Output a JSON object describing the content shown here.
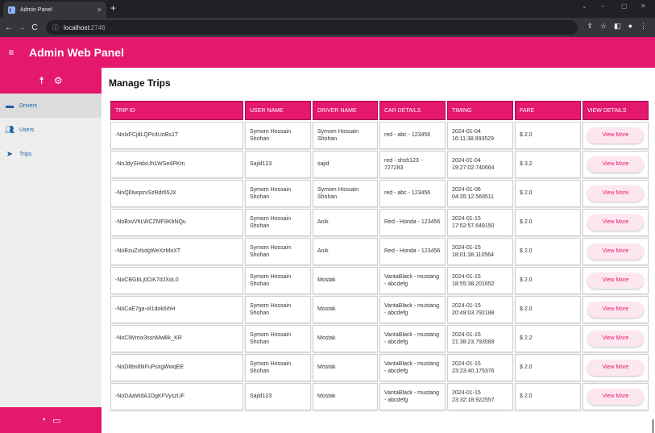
{
  "browser": {
    "tab_title": "Admin Panel",
    "tab_close": "×",
    "new_tab": "+",
    "address_host": "localhost:",
    "address_port": "2746",
    "window_controls": [
      "⌄",
      "–",
      "▢",
      "✕"
    ]
  },
  "app": {
    "title": "Admin Web Panel"
  },
  "main": {
    "page_title": "Manage Trips",
    "table": {
      "headers": [
        "TRIP ID",
        "USER NAME",
        "DRIVER NAME",
        "CAR DETAILS",
        "TIMING",
        "FARE",
        "VIEW DETAILS"
      ],
      "rows": [
        {
          "trip_id": "-NnIxFCjdLQPc4UoBs1T",
          "user": "Symom Hossain Shohan",
          "driver": "Symom Hossain Shohan",
          "car": "red - abc - 123456",
          "timing": "2024-01-04 16:11:38.993529",
          "fare": "$ 2.0",
          "action": "View More"
        },
        {
          "trip_id": "-NnJdySHdxUh1WSe4PKm",
          "user": "Sajid123",
          "driver": "sajid",
          "car": "red - shsh123 - 727283",
          "timing": "2024-01-04 19:27:02.740664",
          "fare": "$ 3.2",
          "action": "View More"
        },
        {
          "trip_id": "-NnQl0wqsrvSzRdr65JX",
          "user": "Symom Hossain Shohan",
          "driver": "Symom Hossain Shohan",
          "car": "red - abc - 123456",
          "timing": "2024-01-06 04:35:12.569511",
          "fare": "$ 2.0",
          "action": "View More"
        },
        {
          "trip_id": "-NoBxvVhLWCZMF9KbNQu",
          "user": "Symom Hossain Shohan",
          "driver": "Anik",
          "car": "Red - Honda - 123456",
          "timing": "2024-01-15 17:52:57.649150",
          "fare": "$ 2.0",
          "action": "View More"
        },
        {
          "trip_id": "-NoBzuZvlsdgWeXzMoXT",
          "user": "Symom Hossain Shohan",
          "driver": "Anik",
          "car": "Red - Honda - 123456",
          "timing": "2024-01-15 18:01:38.110564",
          "fare": "$ 2.0",
          "action": "View More"
        },
        {
          "trip_id": "-NoCBGbLj0CiK7dJXoL0",
          "user": "Symom Hossain Shohan",
          "driver": "Mostak",
          "car": "VantaBlack - mustang - abcdefg",
          "timing": "2024-01-15 18:55:38.201652",
          "fare": "$ 2.0",
          "action": "View More"
        },
        {
          "trip_id": "-NoCaE7ga-oI1dok6ihH",
          "user": "Symom Hossain Shohan",
          "driver": "Mostak",
          "car": "VantaBlack - mustang - abcdefg",
          "timing": "2024-01-15 20:49:03.792188",
          "fare": "$ 2.0",
          "action": "View More"
        },
        {
          "trip_id": "-NoClWmix3ssnMwBk_KR",
          "user": "Symom Hossain Shohan",
          "driver": "Mostak",
          "car": "VantaBlack - mustang - abcdefg",
          "timing": "2024-01-15 21:38:23.793589",
          "fare": "$ 2.2",
          "action": "View More"
        },
        {
          "trip_id": "-NoD8bs8NFuPsxgWwqEE",
          "user": "Symom Hossain Shohan",
          "driver": "Mostak",
          "car": "VantaBlack - mustang - abcdefg",
          "timing": "2024-01-15 23:23:40.175376",
          "fare": "$ 2.0",
          "action": "View More"
        },
        {
          "trip_id": "-NoDAaWdA1DgKFVyszUF",
          "user": "Sajid123",
          "driver": "Mostak",
          "car": "VantaBlack - mustang - abcdefg",
          "timing": "2024-01-15 23:32:18.922557",
          "fare": "$ 2.0",
          "action": "View More"
        }
      ]
    }
  },
  "sidebar": {
    "items": [
      {
        "label": "Drivers",
        "icon": "car-icon",
        "active": true
      },
      {
        "label": "Users",
        "icon": "users-icon",
        "active": false
      },
      {
        "label": "Trips",
        "icon": "navigation-icon",
        "active": false
      }
    ]
  },
  "colors": {
    "brand": "#e4186e",
    "link": "#1d5fa8"
  }
}
